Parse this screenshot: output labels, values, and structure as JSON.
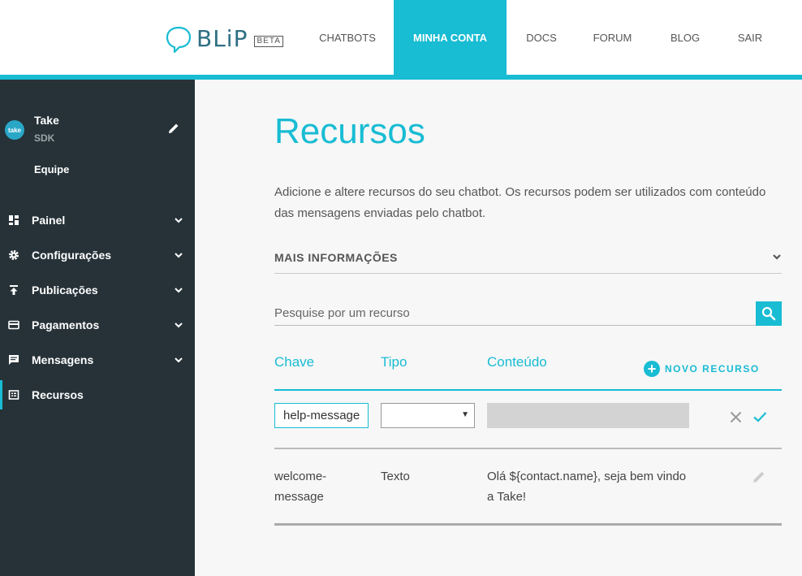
{
  "app": {
    "logo_text": "BLiP",
    "logo_badge": "BETA",
    "brand_color": "#18bcd3",
    "sidebar_color": "#263238"
  },
  "nav": {
    "items": [
      {
        "label": "CHATBOTS",
        "active": false
      },
      {
        "label": "MINHA CONTA",
        "active": true
      },
      {
        "label": "DOCS",
        "active": false
      },
      {
        "label": "FORUM",
        "active": false
      },
      {
        "label": "BLOG",
        "active": false
      },
      {
        "label": "SAIR",
        "active": false
      }
    ]
  },
  "sidebar": {
    "bot": {
      "avatar_text": "take",
      "name": "Take",
      "subtitle": "SDK"
    },
    "team_label": "Equipe",
    "items": [
      {
        "label": "Painel",
        "icon": "dashboard-icon",
        "has_submenu": true
      },
      {
        "label": "Configurações",
        "icon": "gear-icon",
        "has_submenu": true
      },
      {
        "label": "Publicações",
        "icon": "upload-icon",
        "has_submenu": true
      },
      {
        "label": "Pagamentos",
        "icon": "credit-card-icon",
        "has_submenu": true
      },
      {
        "label": "Mensagens",
        "icon": "message-icon",
        "has_submenu": true
      },
      {
        "label": "Recursos",
        "icon": "resources-icon",
        "has_submenu": false,
        "active": true
      }
    ]
  },
  "main": {
    "title": "Recursos",
    "description": "Adicione e altere recursos do seu chatbot. Os recursos podem ser utilizados com conteúdo das mensagens enviadas pelo chatbot.",
    "more_info_label": "MAIS INFORMAÇÕES",
    "search": {
      "placeholder": "Pesquise por um recurso",
      "value": ""
    },
    "table": {
      "columns": [
        "Chave",
        "Tipo",
        "Conteúdo"
      ],
      "new_resource_label": "NOVO RECURSO",
      "edit_row": {
        "key": "help-message",
        "type": "",
        "content": ""
      },
      "rows": [
        {
          "key_line1": "welcome-",
          "key_line2": "message",
          "type": "Texto",
          "content_line1": "Olá ${contact.name}, seja bem vindo",
          "content_line2": "a Take!"
        }
      ]
    }
  }
}
